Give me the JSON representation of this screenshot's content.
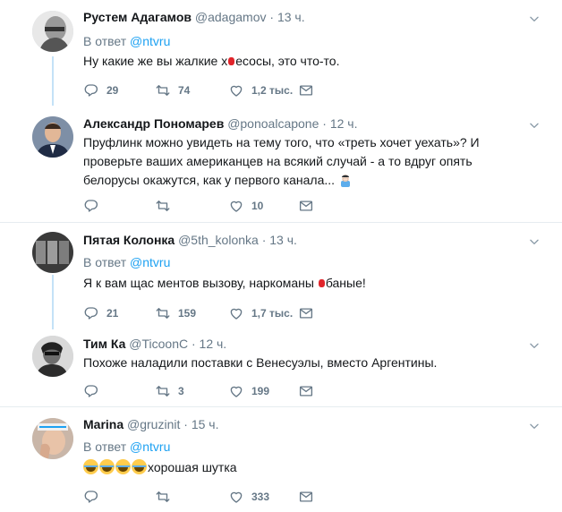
{
  "tweets": [
    {
      "name": "Рустем Адагамов",
      "handle": "@adagamov",
      "time": "13 ч.",
      "reply_prefix": "В ответ",
      "reply_to": "@ntvru",
      "text_before": "Ну какие же вы жалкие х",
      "text_after": "есосы, это что-то.",
      "replies": "29",
      "retweets": "74",
      "likes": "1,2 тыс."
    },
    {
      "name": "Александр Пономарев",
      "handle": "@ponoalcapone",
      "time": "12 ч.",
      "text": "Пруфлинк можно увидеть на тему того, что «треть хочет уехать»? И проверьте ваших американцев на всякий случай - а то вдруг опять белорусы окажутся, как у первого канала...",
      "replies": "",
      "retweets": "",
      "likes": "10"
    },
    {
      "name": "Пятая Колонка",
      "handle": "@5th_kolonka",
      "time": "13 ч.",
      "reply_prefix": "В ответ",
      "reply_to": "@ntvru",
      "text_before": "Я к вам щас ментов вызову, наркоманы ",
      "text_after": "баные!",
      "replies": "21",
      "retweets": "159",
      "likes": "1,7 тыс."
    },
    {
      "name": "Тим Ка",
      "handle": "@TicoonC",
      "time": "12 ч.",
      "text": "Похоже наладили поставки с Венесуэлы, вместо Аргентины.",
      "replies": "",
      "retweets": "3",
      "likes": "199"
    },
    {
      "name": "Marina",
      "handle": "@gruzinit",
      "time": "15 ч.",
      "reply_prefix": "В ответ",
      "reply_to": "@ntvru",
      "text": "хорошая шутка",
      "replies": "",
      "retweets": "",
      "likes": "333"
    }
  ],
  "colors": {
    "accent": "#1da1f2",
    "muted": "#657786",
    "thread": "#c4e2f7"
  },
  "icons": [
    "reply-icon",
    "retweet-icon",
    "like-icon",
    "message-icon",
    "caret-down-icon"
  ]
}
